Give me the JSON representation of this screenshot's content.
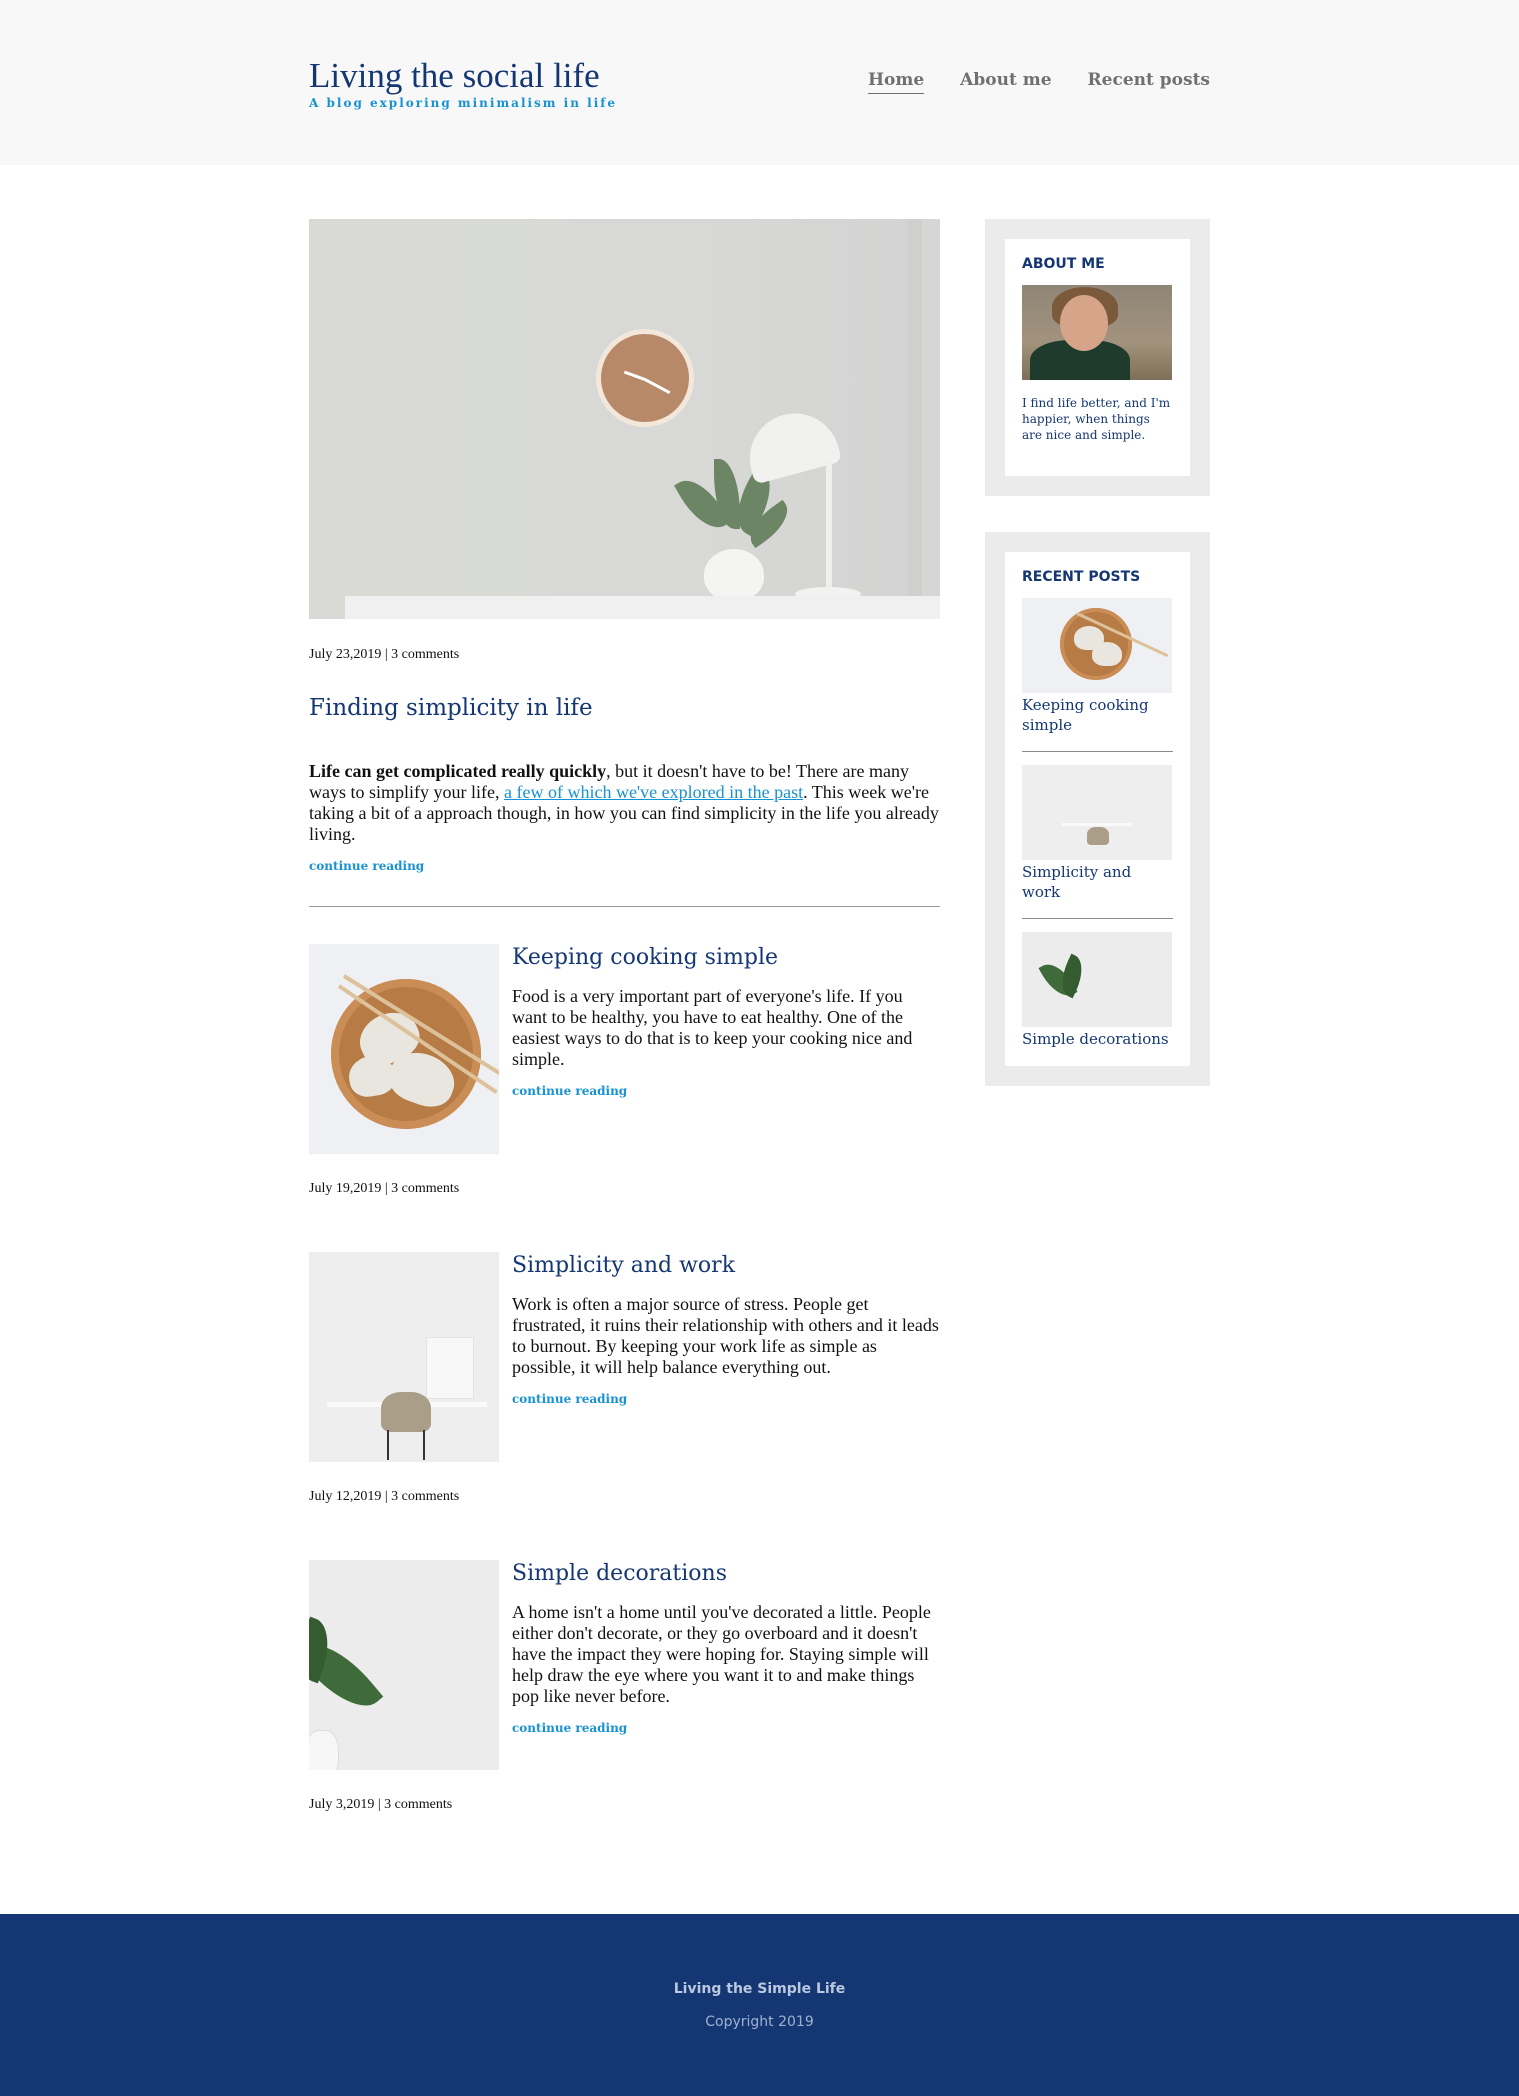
{
  "header": {
    "title": "Living the social life",
    "subtitle": "A blog exploring minimalism in life",
    "nav": [
      {
        "label": "Home",
        "active": true
      },
      {
        "label": "About me",
        "active": false
      },
      {
        "label": "Recent posts",
        "active": false
      }
    ]
  },
  "featured": {
    "meta": "July 23,2019 | 3 comments",
    "title": "Finding simplicity in life",
    "body_bold": "Life can get complicated really quickly",
    "body_pre_link": ", but it doesn't have to be! There are many ways to simplify your life, ",
    "body_link": "a few of which we've explored in the past",
    "body_post_link": ". This week we're taking a bit of a approach though, in how you can find simplicity in the life you already living.",
    "continue_label": "continue reading"
  },
  "posts": [
    {
      "title": "Keeping cooking simple",
      "text": "Food is a very important part of everyone's life. If you want to be healthy, you have to eat healthy. One of the easiest ways to do that is to keep your cooking nice and simple.",
      "continue_label": "continue reading",
      "meta": "July 19,2019 | 3 comments"
    },
    {
      "title": "Simplicity and work",
      "text": "Work is often a major source of stress. People get frustrated, it ruins their relationship with others and it leads to burnout. By keeping your work life as simple as possible, it will help balance everything out.",
      "continue_label": "continue reading",
      "meta": "July 12,2019 | 3 comments"
    },
    {
      "title": "Simple decorations",
      "text": "A home isn't a home until you've decorated a little. People either don't decorate, or they go overboard and it doesn't have the impact they were hoping for. Staying simple will help draw the eye where you want it to and make things pop like never before.",
      "continue_label": "continue reading",
      "meta": "July 3,2019 | 3 comments"
    }
  ],
  "sidebar": {
    "about": {
      "title": "ABOUT ME",
      "text": "I find life better, and I'm happier, when things are nice and simple."
    },
    "recent": {
      "title": "RECENT POSTS",
      "items": [
        {
          "label": "Keeping cooking simple"
        },
        {
          "label": "Simplicity and work"
        },
        {
          "label": "Simple decorations"
        }
      ]
    }
  },
  "footer": {
    "title": "Living the Simple Life",
    "copyright": "Copyright 2019"
  },
  "colors": {
    "brand_navy": "#143774",
    "accent_blue": "#1792d2",
    "header_bg": "#f8f8f8",
    "sidebar_bg": "#ebebeb"
  }
}
